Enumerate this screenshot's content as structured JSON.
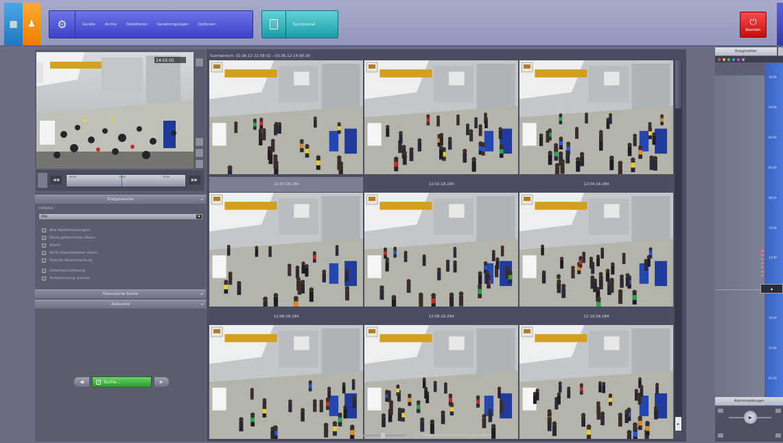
{
  "topbar": {
    "menu_items": [
      "Geräte",
      "Archiv",
      "Detektoren",
      "Genehmigungen",
      "Optionen"
    ],
    "journal_label": "Suchjournal",
    "quit_label": "Beenden"
  },
  "left": {
    "preview_overlay": "14:55:01",
    "timeline_ticks": [
      "09:00",
      "12:00",
      "15:00"
    ],
    "sections": {
      "event_search": "Ereignissuche",
      "forensic_search": "Forensische Suche",
      "time_search": "Zeitsuche"
    },
    "initiator_label": "Initiator:",
    "initiator_value": "Alle",
    "checks": [
      "Alle Alarmmeldungen",
      "Nicht gefährlicher Alarm",
      "Alarm",
      "Nicht klassifizierter Alarm",
      "Falsche Alarmmeldung",
      "Detektorauslösung",
      "Aufzeichnung starten"
    ],
    "search_button": "Suche..."
  },
  "center": {
    "search_range": "Suchbereich: 02.06.12 22:58:02 – 03.06.12 14:58:16",
    "timestamps": [
      "12:00:18.284",
      "12:02:18.284",
      "12:04:18.284",
      "12:06:18.284",
      "12:08:18.284",
      "12:10:18.284",
      "",
      "",
      ""
    ],
    "selected_index": 0,
    "zoom_label": "Objekt der Alarmmeldung vergrößern"
  },
  "right": {
    "header": "Ereignisfilter",
    "timeline_labels": [
      "16:00",
      "20:00",
      "00:00",
      "04:00",
      "08:00",
      "10:00",
      "14:00",
      "16:00",
      "18:00",
      "22:00",
      "02:00"
    ],
    "alarm_header": "Alarmmeldungen"
  },
  "colors": {
    "menu_blue": "#4a50d6",
    "journal_teal": "#2cb3bc",
    "quit_red": "#e02020",
    "search_green": "#3fb03f",
    "corner_blue": "#2b8fd8",
    "corner_orange": "#f58a0a"
  }
}
